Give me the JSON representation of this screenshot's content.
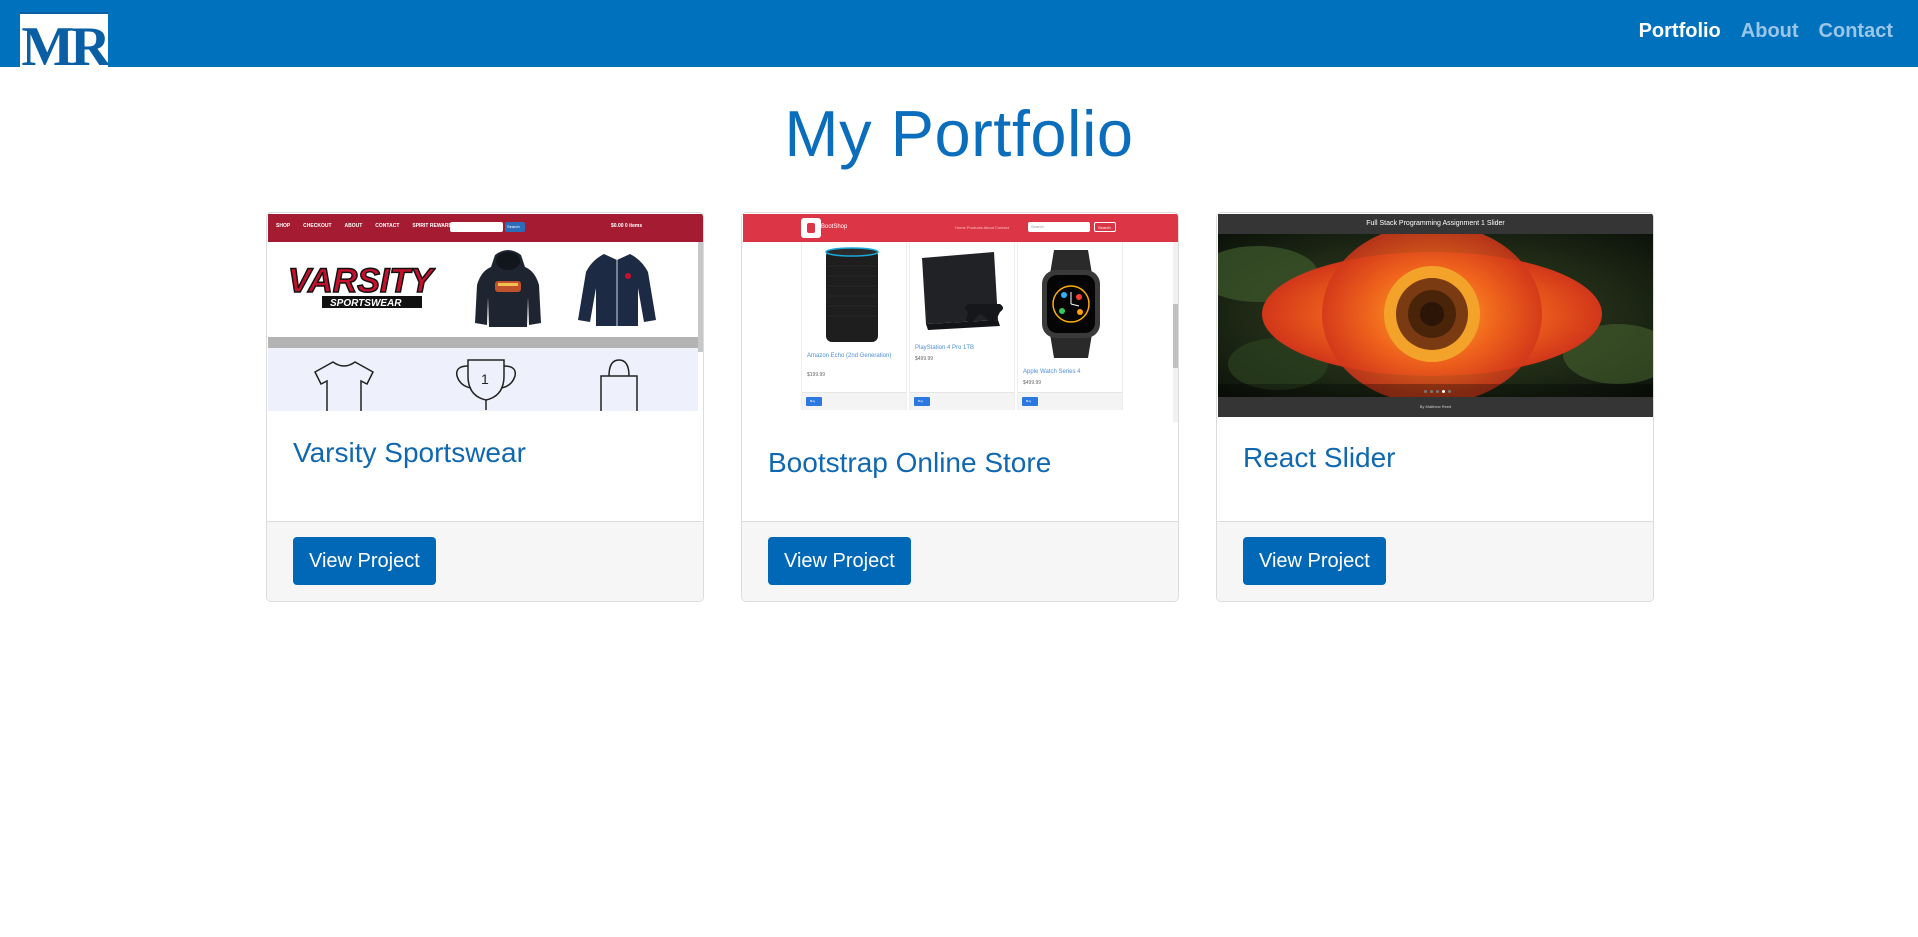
{
  "nav": {
    "logo_text": "MR",
    "links": [
      "Portfolio",
      "About",
      "Contact"
    ]
  },
  "page": {
    "title": "My Portfolio"
  },
  "projects": [
    {
      "title": "Varsity Sportswear",
      "button": "View Project",
      "thumb": {
        "menu": [
          "SHOP",
          "CHECKOUT",
          "ABOUT",
          "CONTACT",
          "SPIRIT REWARDS"
        ],
        "search_button": "Search",
        "cart": "$0.00  0 items",
        "logo_text": "VARSITY",
        "logo_subtext": "SPORTSWEAR",
        "trophy_number": "1"
      }
    },
    {
      "title": "Bootstrap Online Store",
      "button": "View Project",
      "thumb": {
        "brand": "BootShop",
        "links": "Home  Products  About  Contact",
        "search_placeholder": "Search",
        "search_button": "Search",
        "products": [
          {
            "name": "Amazon Echo (2nd Generation)",
            "price": "$199.99",
            "buy": "Buy"
          },
          {
            "name": "PlayStation 4 Pro 1TB",
            "price": "$499.99",
            "buy": "Buy"
          },
          {
            "name": "Apple Watch Series 4",
            "price": "$499.99",
            "buy": "Buy"
          }
        ]
      }
    },
    {
      "title": "React Slider",
      "button": "View Project",
      "thumb": {
        "header": "Full Stack Programming Assignment 1 Slider",
        "footer": "By Matthew Reed"
      }
    }
  ],
  "colors": {
    "navbar": "#0071bc",
    "accent": "#0a6ebc",
    "button": "#0068b7",
    "varsity_red": "#a51b32",
    "bootstrap_red": "#dc3545"
  }
}
